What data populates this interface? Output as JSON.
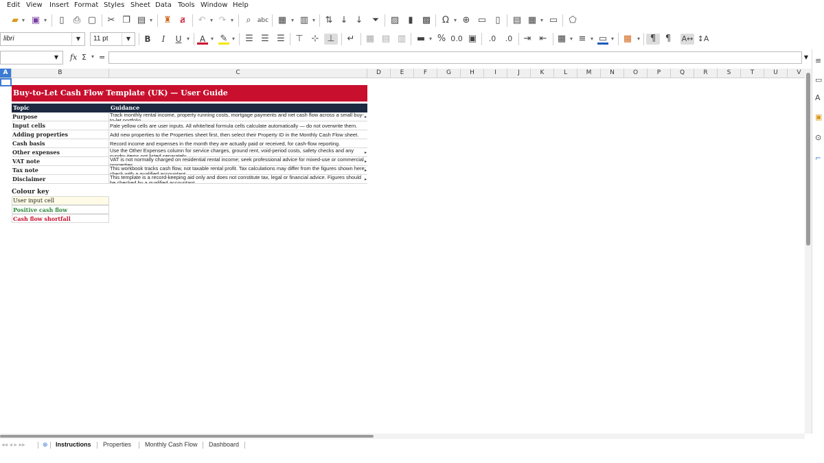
{
  "menu": [
    "Edit",
    "View",
    "Insert",
    "Format",
    "Styles",
    "Sheet",
    "Data",
    "Tools",
    "Window",
    "Help"
  ],
  "toolbar1_icons": [
    "folder-open-icon",
    "save-icon",
    "export-pdf-icon",
    "print-icon",
    "print-preview-icon",
    "cut-icon",
    "copy-icon",
    "paste-icon",
    "clone-format-icon",
    "clear-format-icon",
    "undo-icon",
    "redo-icon",
    "find-replace-icon",
    "spelling-icon",
    "row-icon",
    "column-icon",
    "sort-icon",
    "sort-ascending-icon",
    "sort-descending-icon",
    "autofilter-icon",
    "image-icon",
    "chart-icon",
    "pivot-table-icon",
    "special-character-icon",
    "hyperlink-icon",
    "comment-icon",
    "header-footer-icon",
    "define-print-area-icon",
    "freeze-rows-columns-icon",
    "split-window-icon",
    "show-draw-functions-icon"
  ],
  "font": {
    "name": "libri",
    "size": "11 pt"
  },
  "format_labels": {
    "bold": "B",
    "italic": "I",
    "underline": "U",
    "font_color": "A",
    "percent": "%",
    "decimals_add": ".0",
    "decimals_del": ".0"
  },
  "formula_bar": {
    "cell_ref": "",
    "fx": "fx",
    "sum": "Σ",
    "equals": "=",
    "content": ""
  },
  "columns": [
    "A",
    "B",
    "C",
    "D",
    "E",
    "F",
    "G",
    "H",
    "I",
    "J",
    "K",
    "L",
    "M",
    "N",
    "O",
    "P",
    "Q",
    "R",
    "S",
    "T",
    "U",
    "V"
  ],
  "selected_column": "A",
  "sheet": {
    "title": "Buy-to-Let Cash Flow Template (UK) — User Guide",
    "header": {
      "topic": "Topic",
      "guidance": "Guidance"
    },
    "rows": [
      {
        "topic": "Purpose",
        "guidance": "Track monthly rental income, property running costs, mortgage payments and net cash flow across a small buy-to-let portfolio."
      },
      {
        "topic": "Input cells",
        "guidance": "Pale yellow cells are user inputs. All white/teal formula cells calculate automatically — do not overwrite them."
      },
      {
        "topic": "Adding properties",
        "guidance": "Add new properties to the Properties sheet first, then select their Property ID in the Monthly Cash Flow sheet."
      },
      {
        "topic": "Cash basis",
        "guidance": "Record income and expenses in the month they are actually paid or received, for cash-flow reporting."
      },
      {
        "topic": "Other expenses",
        "guidance": "Use the Other Expenses column for service charges, ground rent, void-period costs, safety checks and any sundry items not listed separately."
      },
      {
        "topic": "VAT note",
        "guidance": "VAT is not normally charged on residential rental income; seek professional advice for mixed-use or commercial properties."
      },
      {
        "topic": "Tax note",
        "guidance": "This workbook tracks cash flow, not taxable rental profit. Tax calculations may differ from the figures shown here; check with a qualified accountant."
      },
      {
        "topic": "Disclaimer",
        "guidance": "This template is a record-keeping aid only and does not constitute tax, legal or financial advice. Figures should be checked by a qualified accountant."
      }
    ],
    "colour_key": {
      "heading": "Colour key",
      "items": [
        {
          "label": "User input cell",
          "color": "#222222",
          "bg": "#fffbe6"
        },
        {
          "label": "Positive cash flow",
          "color": "#2e8b3a",
          "bg": "#ffffff"
        },
        {
          "label": "Cash flow shortfall",
          "color": "#c8102e",
          "bg": "#ffffff"
        }
      ]
    }
  },
  "tabs": [
    "Instructions",
    "Properties",
    "Monthly Cash Flow",
    "Dashboard"
  ],
  "active_tab": "Instructions",
  "colors": {
    "accent": "#c8102e",
    "header_dark": "#1c2940",
    "selection": "#3a7bd5"
  }
}
